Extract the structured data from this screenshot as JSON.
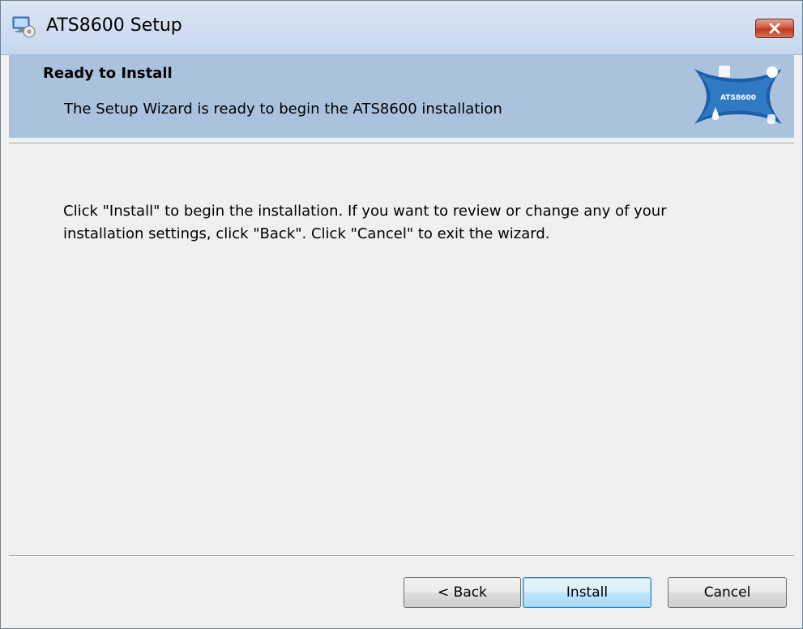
{
  "window": {
    "title": "ATS8600 Setup",
    "app_icon": "setup-installer-icon",
    "close_icon": "close-x-icon"
  },
  "banner": {
    "title": "Ready to Install",
    "subtitle": "The Setup Wizard is ready to begin the ATS8600 installation",
    "logo_text": "ATS8600",
    "logo_icon": "ats8600-logo"
  },
  "body": {
    "message": "Click \"Install\" to begin the installation.  If you want to review or change any of your installation settings, click \"Back\".  Click \"Cancel\" to exit the wizard."
  },
  "buttons": {
    "back": "< Back",
    "install": "Install",
    "cancel": "Cancel"
  },
  "colors": {
    "banner_bg": "#aac2de",
    "window_bg": "#f0f0f0",
    "close_button": "#c0381c",
    "logo_blue": "#1a5fa8"
  }
}
